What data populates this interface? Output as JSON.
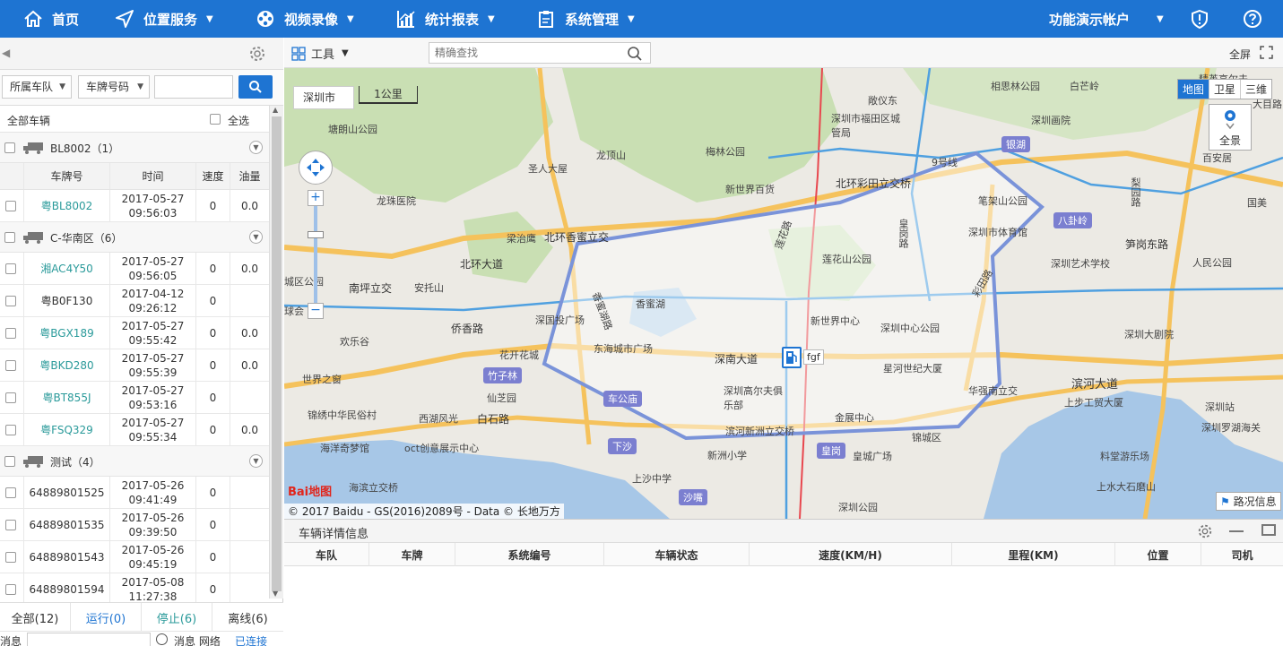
{
  "nav": {
    "items": [
      {
        "label": "首页",
        "icon": "home-icon"
      },
      {
        "label": "位置服务",
        "icon": "location-arrow-icon"
      },
      {
        "label": "视频录像",
        "icon": "video-reel-icon"
      },
      {
        "label": "统计报表",
        "icon": "chart-icon"
      },
      {
        "label": "系统管理",
        "icon": "clipboard-icon"
      }
    ],
    "account": "功能演示帐户",
    "accent_color": "#1e74d2"
  },
  "left": {
    "filters": {
      "fleet": "所属车队",
      "plate_type": "车牌号码",
      "search_value": ""
    },
    "all_vehicles": "全部车辆",
    "select_all": "全选",
    "columns": {
      "plate": "车牌号",
      "time": "时间",
      "speed": "速度",
      "oil": "油量"
    },
    "groups": [
      {
        "name": "BL8002（1）",
        "vehicles": [
          {
            "plate": "粤BL8002",
            "date": "2017-05-27",
            "time": "09:56:03",
            "speed": "0",
            "oil": "0.0",
            "online": true
          }
        ]
      },
      {
        "name": "C-华南区（6）",
        "vehicles": [
          {
            "plate": "湘AC4Y50",
            "date": "2017-05-27",
            "time": "09:56:05",
            "speed": "0",
            "oil": "0.0",
            "online": true
          },
          {
            "plate": "粤B0F130",
            "date": "2017-04-12",
            "time": "09:26:12",
            "speed": "0",
            "oil": "",
            "online": false
          },
          {
            "plate": "粤BGX189",
            "date": "2017-05-27",
            "time": "09:55:42",
            "speed": "0",
            "oil": "0.0",
            "online": true
          },
          {
            "plate": "粤BKD280",
            "date": "2017-05-27",
            "time": "09:55:39",
            "speed": "0",
            "oil": "0.0",
            "online": true
          },
          {
            "plate": "粤BT855J",
            "date": "2017-05-27",
            "time": "09:53:16",
            "speed": "0",
            "oil": "",
            "online": true
          },
          {
            "plate": "粤FSQ329",
            "date": "2017-05-27",
            "time": "09:55:34",
            "speed": "0",
            "oil": "0.0",
            "online": true
          }
        ]
      },
      {
        "name": "测试（4）",
        "vehicles": [
          {
            "plate": "64889801525",
            "date": "2017-05-26",
            "time": "09:41:49",
            "speed": "0",
            "oil": "",
            "online": false
          },
          {
            "plate": "64889801535",
            "date": "2017-05-26",
            "time": "09:39:50",
            "speed": "0",
            "oil": "",
            "online": false
          },
          {
            "plate": "64889801543",
            "date": "2017-05-26",
            "time": "09:45:19",
            "speed": "0",
            "oil": "",
            "online": false
          },
          {
            "plate": "64889801594",
            "date": "2017-05-08",
            "time": "11:27:38",
            "speed": "0",
            "oil": "",
            "online": false
          }
        ]
      }
    ],
    "status_tabs": [
      {
        "label": "全部(12)",
        "color": "#333333"
      },
      {
        "label": "运行(0)",
        "color": "#1e74d2"
      },
      {
        "label": "停止(6)",
        "color": "#2a9a9a"
      },
      {
        "label": "离线(6)",
        "color": "#333333"
      }
    ],
    "bottom": {
      "label": "消息",
      "option_label": "消息 网络",
      "link": "已连接"
    }
  },
  "map": {
    "toolbar": {
      "tools_label": "工具",
      "search_placeholder": "精确查找",
      "fullscreen_label": "全屏"
    },
    "city_select": "深圳市",
    "scale_label": "1公里",
    "map_types": [
      {
        "label": "地图",
        "active": true
      },
      {
        "label": "卫星",
        "active": false
      },
      {
        "label": "三维",
        "active": false
      }
    ],
    "panorama_label": "全景",
    "traffic_label": "路况信息",
    "copyright": "© 2017 Baidu - GS(2016)2089号 - Data © 长地万方",
    "baidu_logo": "Bai地图",
    "vehicle_marker_label": "fgf",
    "labels": [
      {
        "text": "北环大道",
        "kind": "road"
      },
      {
        "text": "北环彩田立交桥",
        "kind": "road"
      },
      {
        "text": "北环香蜜立交",
        "kind": "road"
      },
      {
        "text": "深南大道",
        "kind": "road"
      },
      {
        "text": "滨河大道",
        "kind": "road"
      },
      {
        "text": "白石路",
        "kind": "road"
      },
      {
        "text": "侨香路",
        "kind": "road"
      },
      {
        "text": "华强南立交",
        "kind": "road"
      },
      {
        "text": "深圳市福田区城管局",
        "kind": "poi"
      },
      {
        "text": "深圳画院",
        "kind": "poi"
      },
      {
        "text": "莲花山公园",
        "kind": "poi"
      },
      {
        "text": "香蜜湖",
        "kind": "poi"
      },
      {
        "text": "深圳中心公园",
        "kind": "poi"
      },
      {
        "text": "新世界中心",
        "kind": "poi"
      },
      {
        "text": "笋岗东路",
        "kind": "road"
      },
      {
        "text": "深圳艺术学校",
        "kind": "poi"
      },
      {
        "text": "人民公园",
        "kind": "poi"
      },
      {
        "text": "深圳大剧院",
        "kind": "poi"
      },
      {
        "text": "深圳站",
        "kind": "poi"
      },
      {
        "text": "深圳罗湖海关",
        "kind": "poi"
      },
      {
        "text": "上步工贸大厦",
        "kind": "poi"
      },
      {
        "text": "料堂游乐场",
        "kind": "poi"
      },
      {
        "text": "上水大石磨山",
        "kind": "poi"
      },
      {
        "text": "皇城广场",
        "kind": "poi"
      },
      {
        "text": "金展中心",
        "kind": "poi"
      },
      {
        "text": "新洲小学",
        "kind": "poi"
      },
      {
        "text": "上沙中学",
        "kind": "poi"
      },
      {
        "text": "深圳高尔夫俱乐部",
        "kind": "poi"
      },
      {
        "text": "东海城市广场",
        "kind": "poi"
      },
      {
        "text": "深国投广场",
        "kind": "poi"
      },
      {
        "text": "欢乐谷",
        "kind": "poi"
      },
      {
        "text": "世界之窗",
        "kind": "poi"
      },
      {
        "text": "锦绣中华民俗村",
        "kind": "poi"
      },
      {
        "text": "西湖风光",
        "kind": "poi"
      },
      {
        "text": "海洋奇梦馆",
        "kind": "poi"
      },
      {
        "text": "oct创意展示中心",
        "kind": "poi"
      },
      {
        "text": "花开花城",
        "kind": "poi"
      },
      {
        "text": "仙芝园",
        "kind": "poi"
      },
      {
        "text": "南坪立交",
        "kind": "road"
      },
      {
        "text": "安托山",
        "kind": "poi"
      },
      {
        "text": "梁治鹰",
        "kind": "poi"
      },
      {
        "text": "龙珠医院",
        "kind": "poi"
      },
      {
        "text": "塘朗山公园",
        "kind": "poi"
      },
      {
        "text": "圣人大屋",
        "kind": "poi"
      },
      {
        "text": "龙顶山",
        "kind": "poi"
      },
      {
        "text": "梅林公园",
        "kind": "poi"
      },
      {
        "text": "新世界百货",
        "kind": "poi"
      },
      {
        "text": "笔架山公园",
        "kind": "poi"
      },
      {
        "text": "深圳市体育馆",
        "kind": "poi"
      },
      {
        "text": "星河世纪大厦",
        "kind": "poi"
      },
      {
        "text": "相思林公园",
        "kind": "poi"
      },
      {
        "text": "白芒岭",
        "kind": "poi"
      },
      {
        "text": "精英高尔夫练习场",
        "kind": "poi"
      },
      {
        "text": "敞仪东",
        "kind": "poi"
      },
      {
        "text": "百安居",
        "kind": "poi"
      },
      {
        "text": "国美",
        "kind": "poi"
      },
      {
        "text": "大目路",
        "kind": "poi"
      },
      {
        "text": "莲花路",
        "kind": "road"
      },
      {
        "text": "皇岗路",
        "kind": "road"
      },
      {
        "text": "彩田路",
        "kind": "road"
      },
      {
        "text": "香蜜湖路",
        "kind": "road"
      },
      {
        "text": "梨园路",
        "kind": "road"
      },
      {
        "text": "9号线",
        "kind": "road"
      },
      {
        "text": "城区公园",
        "kind": "poi"
      },
      {
        "text": "深圳公园",
        "kind": "poi"
      },
      {
        "text": "滨河新洲立交桥",
        "kind": "road"
      },
      {
        "text": "海滨立交桥",
        "kind": "road"
      },
      {
        "text": "锦城区",
        "kind": "poi"
      },
      {
        "text": "球会",
        "kind": "poi"
      }
    ],
    "metro": [
      {
        "text": "银湖"
      },
      {
        "text": "八卦岭"
      },
      {
        "text": "竹子林"
      },
      {
        "text": "车公庙"
      },
      {
        "text": "下沙"
      },
      {
        "text": "皇岗"
      },
      {
        "text": "沙嘴"
      }
    ]
  },
  "detail": {
    "title": "车辆详情信息",
    "columns": [
      "车队",
      "车牌",
      "系统编号",
      "车辆状态",
      "速度(KM/H)",
      "里程(KM)",
      "位置",
      "司机"
    ]
  }
}
